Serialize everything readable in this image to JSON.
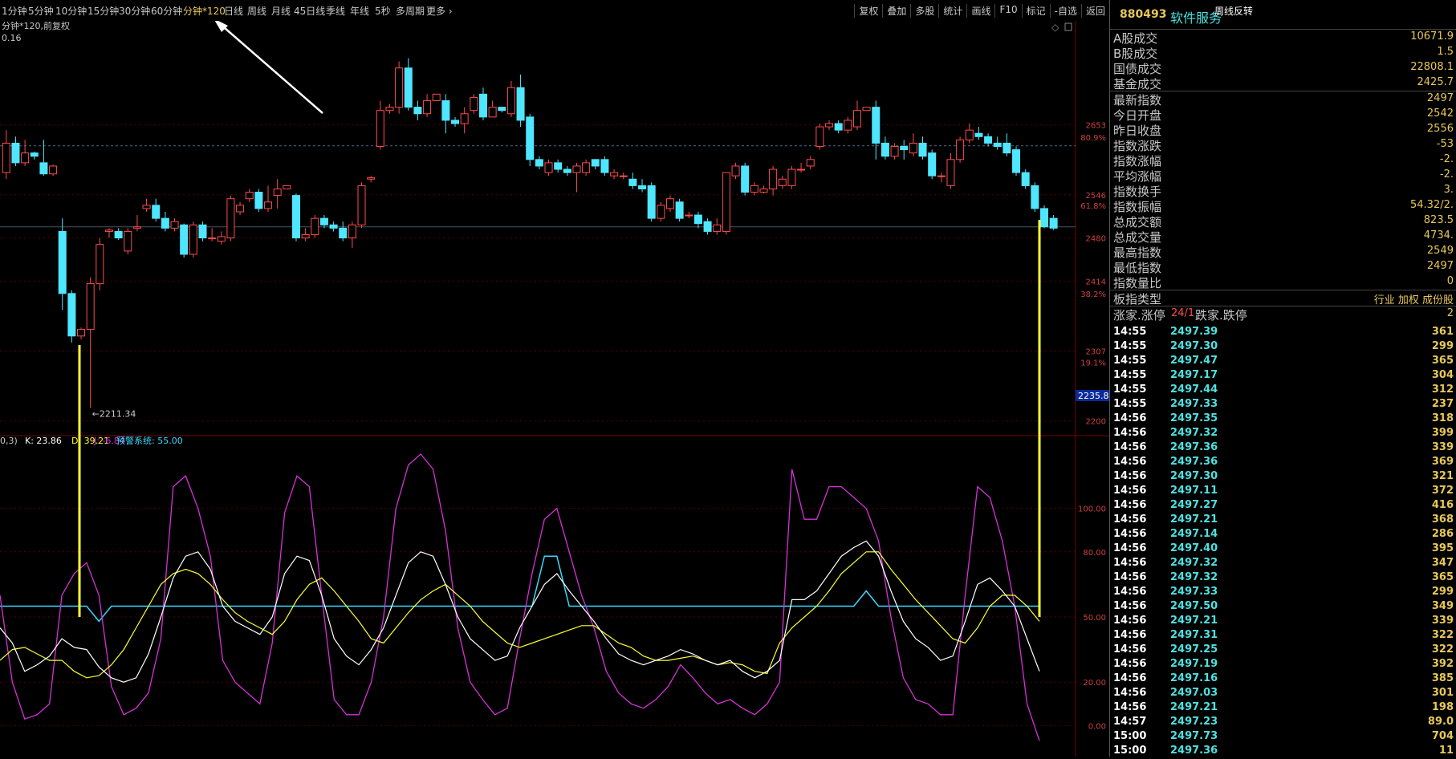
{
  "toolbar": {
    "periods": [
      "1分钟",
      "5分钟",
      "10分钟",
      "15分钟",
      "30分钟",
      "60分钟",
      "分钟*120",
      "日线",
      "周线",
      "月线",
      "45日线",
      "季线",
      "年线",
      "5秒",
      "多周期",
      "更多"
    ],
    "active_period": "分钟*120",
    "right_tools": [
      "复权",
      "叠加",
      "多股",
      "统计",
      "画线",
      "F10",
      "标记",
      "-自选",
      "返回"
    ]
  },
  "chart_header": {
    "title": "分钟*120,前复权",
    "left_value": "0.16"
  },
  "price_axis": {
    "labels": [
      "2653",
      "80.9%",
      "2546",
      "61.8%",
      "2480",
      "2414",
      "38.2%",
      "2307",
      "19.1%",
      "2200"
    ],
    "current_box": "2235.8",
    "low_marker": "2211.34"
  },
  "indicator_legend": {
    "prefix": "0,3)",
    "k": "K: 23.86",
    "d": "D: 39.21",
    "j": "J: -6.84",
    "warning": "预警系统: 55.00"
  },
  "indicator_axis": [
    "100.00",
    "80.00",
    "50.00",
    "20.00",
    "0.00"
  ],
  "colors": {
    "up": "#ff4b4b",
    "down": "#4fe6ff",
    "yellow": "#ffff33",
    "magenta": "#d632d6",
    "cyan": "#3ad8ff",
    "white": "#ffffff"
  },
  "side": {
    "code": "880493",
    "name": "软件服务",
    "tag": "周线反转",
    "stats": [
      {
        "k": "A股成交",
        "v": "10671.9"
      },
      {
        "k": "B股成交",
        "v": "1.5"
      },
      {
        "k": "国债成交",
        "v": "22808.1"
      },
      {
        "k": "基金成交",
        "v": "2425.7"
      },
      {
        "k": "最新指数",
        "v": "2497"
      },
      {
        "k": "今日开盘",
        "v": "2542"
      },
      {
        "k": "昨日收盘",
        "v": "2556"
      },
      {
        "k": "指数涨跌",
        "v": "-53"
      },
      {
        "k": "指数涨幅",
        "v": "-2."
      },
      {
        "k": "平均涨幅",
        "v": "-2."
      },
      {
        "k": "指数换手",
        "v": "3."
      },
      {
        "k": "指数振幅",
        "v": "54.32/2."
      },
      {
        "k": "总成交额",
        "v": "823.5"
      },
      {
        "k": "总成交量",
        "v": "4734."
      },
      {
        "k": "最高指数",
        "v": "2549"
      },
      {
        "k": "最低指数",
        "v": "2497"
      },
      {
        "k": "指数量比",
        "v": "0"
      }
    ],
    "type_row": {
      "k": "板指类型",
      "v": "行业 加权 成份股"
    },
    "updown_row": {
      "k": "涨家.涨停",
      "mid": "24/1",
      "k2": "跌家.跌停",
      "v": "2"
    },
    "ticks": [
      {
        "t": "14:55",
        "p": "2497.39",
        "q": "361"
      },
      {
        "t": "14:55",
        "p": "2497.30",
        "q": "299"
      },
      {
        "t": "14:55",
        "p": "2497.47",
        "q": "365"
      },
      {
        "t": "14:55",
        "p": "2497.17",
        "q": "304"
      },
      {
        "t": "14:55",
        "p": "2497.44",
        "q": "312"
      },
      {
        "t": "14:55",
        "p": "2497.33",
        "q": "237"
      },
      {
        "t": "14:56",
        "p": "2497.35",
        "q": "318"
      },
      {
        "t": "14:56",
        "p": "2497.32",
        "q": "399"
      },
      {
        "t": "14:56",
        "p": "2497.36",
        "q": "339"
      },
      {
        "t": "14:56",
        "p": "2497.36",
        "q": "369"
      },
      {
        "t": "14:56",
        "p": "2497.30",
        "q": "321"
      },
      {
        "t": "14:56",
        "p": "2497.11",
        "q": "372"
      },
      {
        "t": "14:56",
        "p": "2497.27",
        "q": "416"
      },
      {
        "t": "14:56",
        "p": "2497.21",
        "q": "368"
      },
      {
        "t": "14:56",
        "p": "2497.14",
        "q": "286"
      },
      {
        "t": "14:56",
        "p": "2497.40",
        "q": "395"
      },
      {
        "t": "14:56",
        "p": "2497.32",
        "q": "347"
      },
      {
        "t": "14:56",
        "p": "2497.32",
        "q": "365"
      },
      {
        "t": "14:56",
        "p": "2497.33",
        "q": "299"
      },
      {
        "t": "14:56",
        "p": "2497.50",
        "q": "349"
      },
      {
        "t": "14:56",
        "p": "2497.21",
        "q": "339"
      },
      {
        "t": "14:56",
        "p": "2497.31",
        "q": "322"
      },
      {
        "t": "14:56",
        "p": "2497.25",
        "q": "322"
      },
      {
        "t": "14:56",
        "p": "2497.19",
        "q": "392"
      },
      {
        "t": "14:56",
        "p": "2497.16",
        "q": "385"
      },
      {
        "t": "14:56",
        "p": "2497.03",
        "q": "301"
      },
      {
        "t": "14:56",
        "p": "2497.21",
        "q": "198"
      },
      {
        "t": "14:57",
        "p": "2497.23",
        "q": "89.0"
      },
      {
        "t": "15:00",
        "p": "2497.73",
        "q": "704"
      },
      {
        "t": "15:00",
        "p": "2497.36",
        "q": "11"
      }
    ]
  },
  "chart_data": {
    "type": "candlestick",
    "candles": [
      [
        2580,
        2625,
        2645,
        2570
      ],
      [
        2625,
        2595,
        2635,
        2590
      ],
      [
        2595,
        2610,
        2630,
        2590
      ],
      [
        2610,
        2605,
        2612,
        2600
      ],
      [
        2595,
        2578,
        2630,
        2575
      ],
      [
        2578,
        2590,
        2592,
        2575
      ],
      [
        2490,
        2395,
        2510,
        2370
      ],
      [
        2395,
        2330,
        2400,
        2320
      ],
      [
        2330,
        2340,
        2343,
        2325
      ],
      [
        2340,
        2410,
        2420,
        2220
      ],
      [
        2410,
        2470,
        2480,
        2400
      ],
      [
        2490,
        2492,
        2495,
        2480
      ],
      [
        2490,
        2480,
        2495,
        2477
      ],
      [
        2460,
        2490,
        2495,
        2455
      ],
      [
        2495,
        2497,
        2515,
        2490
      ],
      [
        2525,
        2530,
        2540,
        2520
      ],
      [
        2530,
        2510,
        2540,
        2505
      ],
      [
        2510,
        2495,
        2520,
        2490
      ],
      [
        2495,
        2505,
        2510,
        2490
      ],
      [
        2500,
        2455,
        2502,
        2450
      ],
      [
        2455,
        2500,
        2505,
        2450
      ],
      [
        2500,
        2480,
        2505,
        2475
      ],
      [
        2480,
        2480,
        2495,
        2475
      ],
      [
        2475,
        2482,
        2490,
        2470
      ],
      [
        2480,
        2540,
        2545,
        2475
      ],
      [
        2520,
        2530,
        2535,
        2515
      ],
      [
        2540,
        2550,
        2555,
        2535
      ],
      [
        2550,
        2525,
        2555,
        2520
      ],
      [
        2525,
        2535,
        2560,
        2520
      ],
      [
        2545,
        2555,
        2570,
        2525
      ],
      [
        2555,
        2560,
        2560,
        2555
      ],
      [
        2545,
        2480,
        2548,
        2475
      ],
      [
        2480,
        2485,
        2495,
        2475
      ],
      [
        2485,
        2510,
        2515,
        2480
      ],
      [
        2510,
        2500,
        2515,
        2495
      ],
      [
        2500,
        2495,
        2505,
        2490
      ],
      [
        2495,
        2480,
        2505,
        2475
      ],
      [
        2480,
        2500,
        2505,
        2465
      ],
      [
        2500,
        2560,
        2565,
        2495
      ],
      [
        2570,
        2572,
        2575,
        2565
      ],
      [
        2620,
        2675,
        2690,
        2615
      ],
      [
        2675,
        2680,
        2685,
        2670
      ],
      [
        2680,
        2740,
        2750,
        2670
      ],
      [
        2740,
        2680,
        2755,
        2675
      ],
      [
        2680,
        2670,
        2690,
        2660
      ],
      [
        2670,
        2690,
        2700,
        2665
      ],
      [
        2690,
        2700,
        2700,
        2690
      ],
      [
        2690,
        2660,
        2700,
        2640
      ],
      [
        2660,
        2655,
        2665,
        2650
      ],
      [
        2655,
        2670,
        2680,
        2640
      ],
      [
        2675,
        2695,
        2700,
        2670
      ],
      [
        2700,
        2665,
        2710,
        2660
      ],
      [
        2665,
        2680,
        2690,
        2665
      ],
      [
        2680,
        2675,
        2680,
        2672
      ],
      [
        2670,
        2710,
        2720,
        2665
      ],
      [
        2710,
        2660,
        2730,
        2650
      ],
      [
        2665,
        2600,
        2670,
        2590
      ],
      [
        2600,
        2590,
        2605,
        2585
      ],
      [
        2580,
        2595,
        2600,
        2575
      ],
      [
        2595,
        2585,
        2600,
        2580
      ],
      [
        2585,
        2580,
        2590,
        2575
      ],
      [
        2580,
        2590,
        2595,
        2550
      ],
      [
        2580,
        2595,
        2600,
        2575
      ],
      [
        2600,
        2590,
        2600,
        2585
      ],
      [
        2600,
        2580,
        2605,
        2575
      ],
      [
        2575,
        2580,
        2585,
        2570
      ],
      [
        2575,
        2575,
        2580,
        2570
      ],
      [
        2570,
        2560,
        2580,
        2555
      ],
      [
        2560,
        2555,
        2570,
        2550
      ],
      [
        2560,
        2510,
        2565,
        2505
      ],
      [
        2510,
        2530,
        2535,
        2505
      ],
      [
        2525,
        2540,
        2545,
        2520
      ],
      [
        2535,
        2510,
        2540,
        2505
      ],
      [
        2515,
        2515,
        2520,
        2510
      ],
      [
        2515,
        2502,
        2520,
        2495
      ],
      [
        2505,
        2490,
        2510,
        2485
      ],
      [
        2490,
        2500,
        2510,
        2485
      ],
      [
        2490,
        2580,
        2580,
        2485
      ],
      [
        2575,
        2590,
        2595,
        2570
      ],
      [
        2590,
        2550,
        2595,
        2545
      ],
      [
        2550,
        2560,
        2565,
        2545
      ],
      [
        2550,
        2555,
        2560,
        2548
      ],
      [
        2555,
        2585,
        2590,
        2545
      ],
      [
        2560,
        2570,
        2575,
        2555
      ],
      [
        2560,
        2585,
        2590,
        2555
      ],
      [
        2585,
        2585,
        2595,
        2580
      ],
      [
        2590,
        2600,
        2605,
        2585
      ],
      [
        2620,
        2650,
        2655,
        2615
      ],
      [
        2650,
        2655,
        2660,
        2645
      ],
      [
        2655,
        2645,
        2660,
        2640
      ],
      [
        2645,
        2660,
        2665,
        2640
      ],
      [
        2650,
        2675,
        2690,
        2645
      ],
      [
        2675,
        2680,
        2680,
        2675
      ],
      [
        2680,
        2625,
        2690,
        2600
      ],
      [
        2625,
        2605,
        2635,
        2600
      ],
      [
        2605,
        2620,
        2625,
        2600
      ],
      [
        2620,
        2615,
        2630,
        2600
      ],
      [
        2610,
        2625,
        2640,
        2605
      ],
      [
        2625,
        2605,
        2635,
        2600
      ],
      [
        2610,
        2575,
        2615,
        2570
      ],
      [
        2575,
        2575,
        2580,
        2565
      ],
      [
        2560,
        2600,
        2610,
        2555
      ],
      [
        2600,
        2630,
        2635,
        2595
      ],
      [
        2630,
        2645,
        2655,
        2625
      ],
      [
        2640,
        2635,
        2650,
        2630
      ],
      [
        2635,
        2625,
        2640,
        2620
      ],
      [
        2625,
        2620,
        2635,
        2615
      ],
      [
        2625,
        2610,
        2640,
        2605
      ],
      [
        2615,
        2580,
        2620,
        2575
      ],
      [
        2580,
        2560,
        2585,
        2555
      ],
      [
        2560,
        2525,
        2565,
        2520
      ],
      [
        2525,
        2497,
        2530,
        2495
      ],
      [
        2510,
        2495,
        2515,
        2492
      ]
    ],
    "k": [
      45,
      38,
      25,
      28,
      32,
      40,
      36,
      35,
      27,
      22,
      20,
      22,
      33,
      50,
      68,
      78,
      80,
      72,
      55,
      48,
      45,
      42,
      50,
      70,
      78,
      76,
      60,
      40,
      32,
      28,
      35,
      45,
      60,
      75,
      80,
      78,
      65,
      50,
      40,
      35,
      30,
      32,
      45,
      55,
      65,
      70,
      62,
      55,
      48,
      40,
      33,
      30,
      28,
      30,
      32,
      35,
      33,
      30,
      28,
      30,
      25,
      22,
      25,
      30,
      58,
      58,
      62,
      70,
      78,
      82,
      85,
      78,
      62,
      48,
      40,
      36,
      30,
      32,
      48,
      65,
      68,
      62,
      55,
      40,
      25
    ],
    "d": [
      30,
      35,
      36,
      33,
      30,
      30,
      25,
      22,
      23,
      28,
      35,
      45,
      55,
      65,
      70,
      72,
      70,
      65,
      58,
      52,
      48,
      45,
      42,
      48,
      58,
      65,
      68,
      62,
      55,
      48,
      40,
      38,
      45,
      52,
      58,
      62,
      65,
      60,
      55,
      48,
      43,
      38,
      36,
      38,
      40,
      42,
      44,
      46,
      46,
      42,
      38,
      36,
      32,
      30,
      30,
      31,
      32,
      30,
      28,
      29,
      28,
      25,
      24,
      38,
      45,
      50,
      55,
      62,
      70,
      75,
      80,
      80,
      72,
      65,
      58,
      52,
      46,
      40,
      38,
      45,
      55,
      60,
      60,
      55,
      48
    ],
    "j": [
      60,
      20,
      3,
      5,
      10,
      60,
      70,
      75,
      60,
      18,
      5,
      8,
      15,
      40,
      110,
      115,
      100,
      78,
      30,
      20,
      15,
      10,
      38,
      98,
      115,
      110,
      60,
      12,
      5,
      5,
      20,
      50,
      100,
      120,
      125,
      118,
      90,
      45,
      20,
      12,
      5,
      8,
      40,
      70,
      95,
      100,
      80,
      60,
      45,
      25,
      15,
      10,
      8,
      12,
      18,
      28,
      22,
      15,
      10,
      12,
      8,
      5,
      10,
      20,
      118,
      95,
      95,
      110,
      110,
      105,
      100,
      85,
      50,
      22,
      12,
      10,
      5,
      5,
      60,
      110,
      105,
      85,
      55,
      10,
      -7
    ],
    "warning": [
      55,
      55,
      55,
      55,
      55,
      55,
      55,
      55,
      55,
      55,
      55,
      55,
      55,
      55,
      55,
      55,
      55,
      55,
      55,
      55,
      55,
      55,
      55,
      55,
      55,
      55,
      55,
      55,
      55,
      55,
      55,
      55,
      55,
      55,
      55,
      55,
      55,
      55,
      55,
      55,
      55,
      55,
      55,
      55,
      55,
      55,
      55,
      55,
      55,
      55,
      55,
      55,
      55,
      55,
      55,
      55,
      55,
      55,
      55,
      55,
      55,
      55,
      55,
      55,
      55,
      55,
      55,
      55,
      55,
      55,
      55,
      55,
      55,
      55,
      55,
      55,
      55,
      55,
      55,
      55,
      55,
      55,
      55,
      55,
      55
    ]
  }
}
